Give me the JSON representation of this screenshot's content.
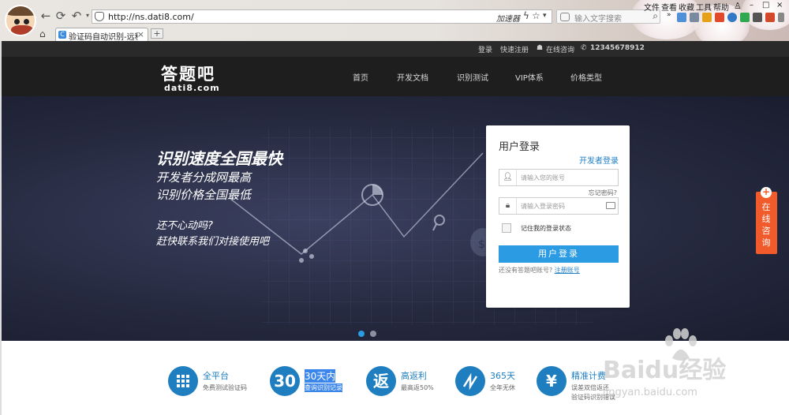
{
  "browser": {
    "url": "http://ns.dati8.com/",
    "accelerator": "加速器",
    "search_placeholder": "输入文字搜索",
    "menu": [
      "文件",
      "查看",
      "收藏",
      "工具",
      "帮助"
    ],
    "tab_title": "验证码自动识别-远程打码"
  },
  "topbar": {
    "login": "登录",
    "register": "快速注册",
    "online": "在线咨询",
    "phone": "12345678912"
  },
  "header": {
    "logo_cn": "答题吧",
    "logo_en": "dati8.com",
    "nav": [
      "首页",
      "开发文档",
      "识别测试",
      "VIP体系",
      "价格类型"
    ]
  },
  "hero": {
    "headline": "识别速度全国最快",
    "line1": "开发者分成网最高",
    "line2": "识别价格全国最低",
    "cta1": "还不心动吗?",
    "cta2": "赶快联系我们对接使用吧"
  },
  "login": {
    "title": "用户登录",
    "developer_login": "开发者登录",
    "username_placeholder": "请输入您的账号",
    "forgot": "忘记密码?",
    "password_placeholder": "请输入登录密码",
    "remember": "记住我的登录状态",
    "submit": "用户登录",
    "no_account": "还没有答题吧账号?",
    "register_link": "注册账号"
  },
  "float_consult": "在线咨询",
  "features": [
    {
      "icon": "grid-icon",
      "glyph": "",
      "title": "全平台",
      "sub": "免费测试验证码"
    },
    {
      "icon": "30-icon",
      "glyph": "30",
      "title": "30天内",
      "sub": "查询识别记录"
    },
    {
      "icon": "return-icon",
      "glyph": "返",
      "title": "高返利",
      "sub": "最高返50%"
    },
    {
      "icon": "365-icon",
      "glyph": "",
      "title": "365天",
      "sub": "全年无休"
    },
    {
      "icon": "yen-icon",
      "glyph": "¥",
      "title": "精准计费",
      "sub": "误差双倍返还",
      "sub2": "验证码识别错误"
    }
  ],
  "watermark": {
    "text": "Baidu经验",
    "url": "jingyan.baidu.com"
  },
  "colors": {
    "accent_blue": "#2b9be3",
    "feature_blue": "#1e7ec0",
    "consult_orange": "#f15a2a",
    "header_dark": "#1e1e1e"
  }
}
